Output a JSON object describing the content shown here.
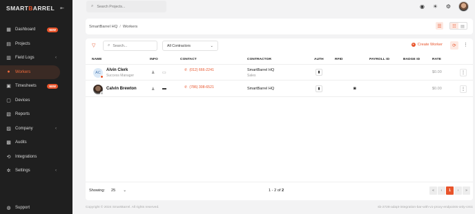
{
  "brand": {
    "name_left": "SMART",
    "name_accent": "B",
    "name_right": "ARREL"
  },
  "sidebar": {
    "items": [
      {
        "label": "Dashboard",
        "icon": "dashboard-icon",
        "glyph": "▦",
        "badge": "NEW"
      },
      {
        "label": "Projects",
        "icon": "projects-icon",
        "glyph": "▤"
      },
      {
        "label": "Field Logs",
        "icon": "field-logs-icon",
        "glyph": "▥",
        "chevron": "‹"
      },
      {
        "label": "Workers",
        "icon": "workers-icon",
        "glyph": "●",
        "active": true
      },
      {
        "label": "Timesheets",
        "icon": "timesheets-icon",
        "glyph": "▣",
        "badge": "NEW"
      },
      {
        "label": "Devices",
        "icon": "devices-icon",
        "glyph": "▢"
      },
      {
        "label": "Reports",
        "icon": "reports-icon",
        "glyph": "▧"
      },
      {
        "label": "Company",
        "icon": "company-icon",
        "glyph": "▨",
        "chevron": "‹"
      },
      {
        "label": "Audits",
        "icon": "audits-icon",
        "glyph": "▩"
      },
      {
        "label": "Integrations",
        "icon": "integrations-icon",
        "glyph": "⟲"
      },
      {
        "label": "Settings",
        "icon": "settings-icon",
        "glyph": "✲",
        "chevron": "‹"
      }
    ],
    "support": "Support"
  },
  "topbar": {
    "search_placeholder": "Search Projects..."
  },
  "breadcrumb": {
    "root": "SmartBarrel HQ",
    "separator": "/",
    "current": "Workers"
  },
  "toolbar": {
    "search_placeholder": "Search...",
    "contractor_filter": "All Contractors",
    "create_label": "Create Worker"
  },
  "table": {
    "headers": {
      "name": "NAME",
      "info": "INFO",
      "contact": "CONTACT",
      "contractor": "CONTRACTOR",
      "auth": "AUTH",
      "rfid": "RFID",
      "payroll": "PAYROLL ID",
      "badge": "BADGE ID",
      "rate": "RATE"
    },
    "rows": [
      {
        "initials": "AC",
        "name": "Alvin Clerk",
        "role": "Success Manager",
        "contact": "(012) 666-2241",
        "contractor": "SmartBarrel HQ",
        "contractor_sub": "Sales",
        "rate": "$0.00"
      },
      {
        "initials": "",
        "name": "Calvin Brewton",
        "role": "",
        "contact": "(786) 308-6521",
        "contractor": "SmartBarrel HQ",
        "contractor_sub": "",
        "rate": "$0.00"
      }
    ]
  },
  "pagination": {
    "showing_label": "Showing:",
    "page_size": "25",
    "range_prefix": "1 - 2 of",
    "total": "2",
    "current_page": "1",
    "first": "«",
    "prev": "‹",
    "next": "›",
    "last": "»"
  },
  "footer": {
    "copyright": "Copyright © 2024 SmartBarrel. All rights reserved.",
    "build": "sb-2728-adapt-integration-bar-with-v1-proxy-endpoints-only-cmic"
  },
  "colors": {
    "accent": "#e8542b",
    "sidebar_bg": "#1f1f1f"
  }
}
